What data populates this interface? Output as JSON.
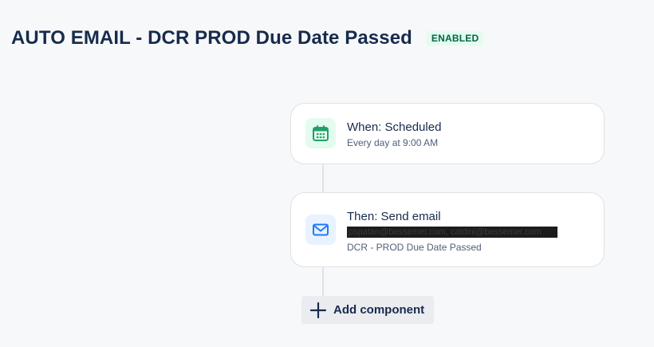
{
  "header": {
    "title": "AUTO EMAIL - DCR PROD Due Date Passed",
    "status": "ENABLED"
  },
  "trigger": {
    "title": "When: Scheduled",
    "subtitle": "Every day at 9:00 AM",
    "icon": "calendar-icon"
  },
  "action": {
    "title": "Then: Send email",
    "recipients": "pspatan@bessemer.com, caldini@bessemer.com",
    "subject": "DCR - PROD Due Date Passed",
    "icon": "mail-icon"
  },
  "add_component": {
    "label": "Add component",
    "icon": "plus-icon"
  },
  "colors": {
    "background": "#f7f8f9",
    "title": "#172b4d",
    "status_bg": "#e3fcef",
    "status_text": "#006644",
    "trigger_icon": "#22a06b",
    "action_icon": "#1d7afc"
  }
}
